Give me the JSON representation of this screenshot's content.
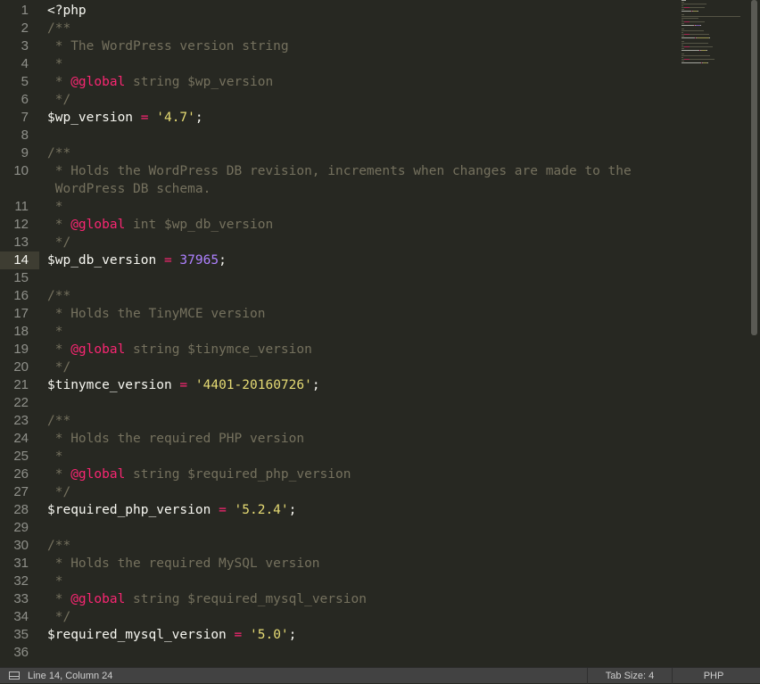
{
  "editor": {
    "active_line": 14,
    "lines": [
      {
        "n": "1",
        "segs": [
          [
            "c-var",
            "<?php"
          ]
        ]
      },
      {
        "n": "2",
        "segs": [
          [
            "c-comment",
            "/**"
          ]
        ]
      },
      {
        "n": "3",
        "segs": [
          [
            "c-comment",
            " * The WordPress version string"
          ]
        ]
      },
      {
        "n": "4",
        "segs": [
          [
            "c-comment",
            " *"
          ]
        ]
      },
      {
        "n": "5",
        "segs": [
          [
            "c-comment",
            " * "
          ],
          [
            "c-keyword",
            "@global"
          ],
          [
            "c-comment",
            " string $wp_version"
          ]
        ]
      },
      {
        "n": "6",
        "segs": [
          [
            "c-comment",
            " */"
          ]
        ]
      },
      {
        "n": "7",
        "segs": [
          [
            "c-var",
            "$wp_version"
          ],
          [
            "c-var",
            " "
          ],
          [
            "c-op",
            "="
          ],
          [
            "c-var",
            " "
          ],
          [
            "c-string",
            "'4.7'"
          ],
          [
            "c-var",
            ";"
          ]
        ]
      },
      {
        "n": "8",
        "segs": []
      },
      {
        "n": "9",
        "segs": [
          [
            "c-comment",
            "/**"
          ]
        ]
      },
      {
        "n": "10",
        "segs": [
          [
            "c-comment",
            " * Holds the WordPress DB revision, increments when changes are made to the"
          ]
        ]
      },
      {
        "n": "",
        "segs": [
          [
            "c-comment",
            " WordPress DB schema."
          ]
        ]
      },
      {
        "n": "11",
        "segs": [
          [
            "c-comment",
            " *"
          ]
        ]
      },
      {
        "n": "12",
        "segs": [
          [
            "c-comment",
            " * "
          ],
          [
            "c-keyword",
            "@global"
          ],
          [
            "c-comment",
            " int $wp_db_version"
          ]
        ]
      },
      {
        "n": "13",
        "segs": [
          [
            "c-comment",
            " */"
          ]
        ]
      },
      {
        "n": "14",
        "segs": [
          [
            "c-var",
            "$wp_db_version"
          ],
          [
            "c-var",
            " "
          ],
          [
            "c-op",
            "="
          ],
          [
            "c-var",
            " "
          ],
          [
            "c-number",
            "37965"
          ],
          [
            "c-var",
            ";"
          ]
        ]
      },
      {
        "n": "15",
        "segs": []
      },
      {
        "n": "16",
        "segs": [
          [
            "c-comment",
            "/**"
          ]
        ]
      },
      {
        "n": "17",
        "segs": [
          [
            "c-comment",
            " * Holds the TinyMCE version"
          ]
        ]
      },
      {
        "n": "18",
        "segs": [
          [
            "c-comment",
            " *"
          ]
        ]
      },
      {
        "n": "19",
        "segs": [
          [
            "c-comment",
            " * "
          ],
          [
            "c-keyword",
            "@global"
          ],
          [
            "c-comment",
            " string $tinymce_version"
          ]
        ]
      },
      {
        "n": "20",
        "segs": [
          [
            "c-comment",
            " */"
          ]
        ]
      },
      {
        "n": "21",
        "segs": [
          [
            "c-var",
            "$tinymce_version"
          ],
          [
            "c-var",
            " "
          ],
          [
            "c-op",
            "="
          ],
          [
            "c-var",
            " "
          ],
          [
            "c-string",
            "'4401-20160726'"
          ],
          [
            "c-var",
            ";"
          ]
        ]
      },
      {
        "n": "22",
        "segs": []
      },
      {
        "n": "23",
        "segs": [
          [
            "c-comment",
            "/**"
          ]
        ]
      },
      {
        "n": "24",
        "segs": [
          [
            "c-comment",
            " * Holds the required PHP version"
          ]
        ]
      },
      {
        "n": "25",
        "segs": [
          [
            "c-comment",
            " *"
          ]
        ]
      },
      {
        "n": "26",
        "segs": [
          [
            "c-comment",
            " * "
          ],
          [
            "c-keyword",
            "@global"
          ],
          [
            "c-comment",
            " string $required_php_version"
          ]
        ]
      },
      {
        "n": "27",
        "segs": [
          [
            "c-comment",
            " */"
          ]
        ]
      },
      {
        "n": "28",
        "segs": [
          [
            "c-var",
            "$required_php_version"
          ],
          [
            "c-var",
            " "
          ],
          [
            "c-op",
            "="
          ],
          [
            "c-var",
            " "
          ],
          [
            "c-string",
            "'5.2.4'"
          ],
          [
            "c-var",
            ";"
          ]
        ]
      },
      {
        "n": "29",
        "segs": []
      },
      {
        "n": "30",
        "segs": [
          [
            "c-comment",
            "/**"
          ]
        ]
      },
      {
        "n": "31",
        "segs": [
          [
            "c-comment",
            " * Holds the required MySQL version"
          ]
        ]
      },
      {
        "n": "32",
        "segs": [
          [
            "c-comment",
            " *"
          ]
        ]
      },
      {
        "n": "33",
        "segs": [
          [
            "c-comment",
            " * "
          ],
          [
            "c-keyword",
            "@global"
          ],
          [
            "c-comment",
            " string $required_mysql_version"
          ]
        ]
      },
      {
        "n": "34",
        "segs": [
          [
            "c-comment",
            " */"
          ]
        ]
      },
      {
        "n": "35",
        "segs": [
          [
            "c-var",
            "$required_mysql_version"
          ],
          [
            "c-var",
            " "
          ],
          [
            "c-op",
            "="
          ],
          [
            "c-var",
            " "
          ],
          [
            "c-string",
            "'5.0'"
          ],
          [
            "c-var",
            ";"
          ]
        ]
      },
      {
        "n": "36",
        "segs": []
      }
    ]
  },
  "status": {
    "position": "Line 14, Column 24",
    "tab_size": "Tab Size: 4",
    "syntax": "PHP",
    "panel_icon": "panel-toggle-icon"
  },
  "colors": {
    "background": "#272822",
    "comment": "#75715e",
    "keyword": "#f92672",
    "string": "#e6db74",
    "number": "#ae81ff",
    "text": "#f8f8f2",
    "statusbar": "#424242"
  }
}
